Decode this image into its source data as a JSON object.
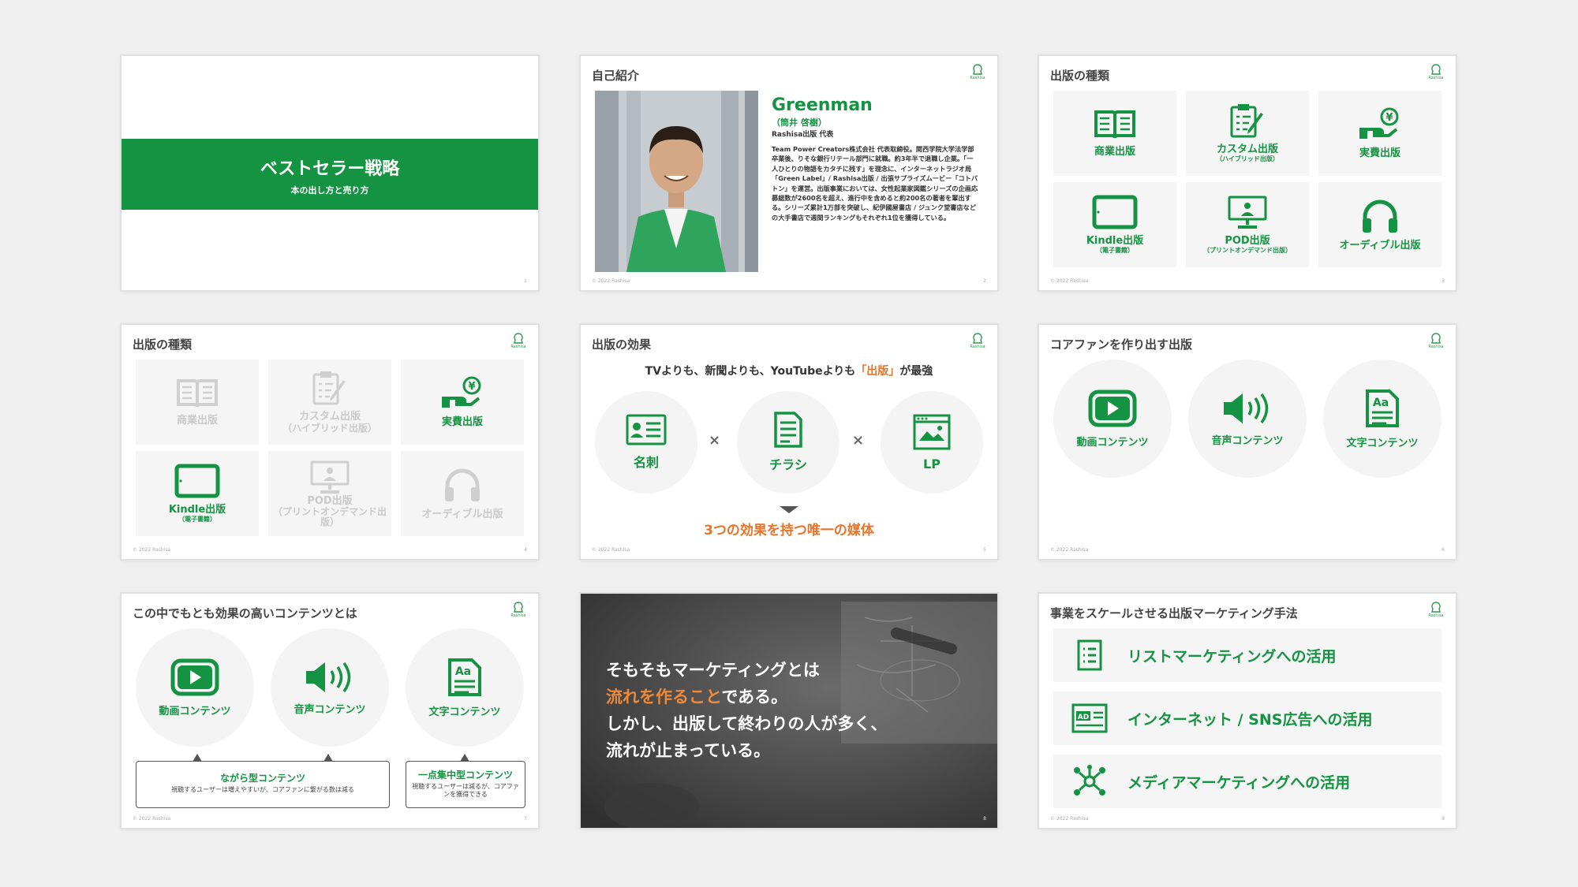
{
  "slides": [
    {
      "title": "ベストセラー戦略",
      "subtitle": "本の出し方と売り方",
      "page": "1"
    },
    {
      "title": "自己紹介",
      "name": "Greenman",
      "name_ja": "（筒井 啓樹）",
      "role": "Rashisa出版 代表",
      "bio": "Team Power Creators株式会社 代表取締役。関西学院大学法学部卒業後、りそな銀行リテール部門に就職。約3年半で退職し企業。「一人ひとりの物語をカタチに残す」を理念に、インターネットラジオ局「Green Label」/ Rashisa出版 / 出張サプライズムービー「コトバトン」を運営。出版事業においては、女性起業家図鑑シリーズの企画応募総数が2600名を超え、進行中を含めると約200名の著者を輩出する。シリーズ累計1万部を突破し、紀伊國屋書店 / ジュンク堂書店などの大手書店で週間ランキングもそれぞれ1位を獲得している。",
      "footer": "© 2022 Rashisa",
      "page": "2"
    },
    {
      "title": "出版の種類",
      "tiles": [
        {
          "label": "商業出版",
          "sub": ""
        },
        {
          "label": "カスタム出版",
          "sub": "（ハイブリッド出版）"
        },
        {
          "label": "実費出版",
          "sub": ""
        },
        {
          "label": "Kindle出版",
          "sub": "（電子書籍）"
        },
        {
          "label": "POD出版",
          "sub": "（プリントオンデマンド出版）"
        },
        {
          "label": "オーディブル出版",
          "sub": ""
        }
      ],
      "footer": "© 2022 Rashisa",
      "page": "3"
    },
    {
      "title": "出版の種類",
      "tiles": [
        {
          "label": "商業出版",
          "sub": ""
        },
        {
          "label": "カスタム出版",
          "sub": "（ハイブリッド出版）"
        },
        {
          "label": "実費出版",
          "sub": ""
        },
        {
          "label": "Kindle出版",
          "sub": "（電子書籍）"
        },
        {
          "label": "POD出版",
          "sub": "（プリントオンデマンド出版）"
        },
        {
          "label": "オーディブル出版",
          "sub": ""
        }
      ],
      "footer": "© 2022 Rashisa",
      "page": "4"
    },
    {
      "title": "出版の効果",
      "headline_pre": "TVよりも、新聞よりも、YouTubeよりも",
      "headline_em": "「出版」",
      "headline_post": "が最強",
      "items": [
        "名刺",
        "チラシ",
        "LP"
      ],
      "times": "×",
      "result": "3つの効果を持つ唯一の媒体",
      "footer": "© 2022 Rashisa",
      "page": "5"
    },
    {
      "title": "コアファンを作り出す出版",
      "items": [
        "動画コンテンツ",
        "音声コンテンツ",
        "文字コンテンツ"
      ],
      "footer": "© 2022 Rashisa",
      "page": "6"
    },
    {
      "title": "この中でもとも効果の高いコンテンツとは",
      "items": [
        "動画コンテンツ",
        "音声コンテンツ",
        "文字コンテンツ"
      ],
      "bubble1_title": "ながら型コンテンツ",
      "bubble1_desc": "視聴するユーザーは増えやすいが、コアファンに繋がる数は減る",
      "bubble2_title": "一点集中型コンテンツ",
      "bubble2_desc": "視聴するユーザーは減るが、コアファンを獲得できる",
      "footer": "© 2022 Rashisa",
      "page": "7"
    },
    {
      "line1": "そもそもマーケティングとは",
      "line2_em": "流れを作ること",
      "line2_post": "である。",
      "line3": "しかし、出版して終わりの人が多く、",
      "line4": "流れが止まっている。",
      "page": "8"
    },
    {
      "title": "事業をスケールさせる出版マーケティング手法",
      "items": [
        "リストマーケティングへの活用",
        "インターネット / SNS広告への活用",
        "メディアマーケティングへの活用"
      ],
      "footer": "© 2022 Rashisa",
      "page": "9"
    }
  ],
  "logo_text": "Rashisa",
  "colors": {
    "brand_green": "#149442",
    "accent_orange": "#e8742a",
    "bg": "#efefef"
  }
}
